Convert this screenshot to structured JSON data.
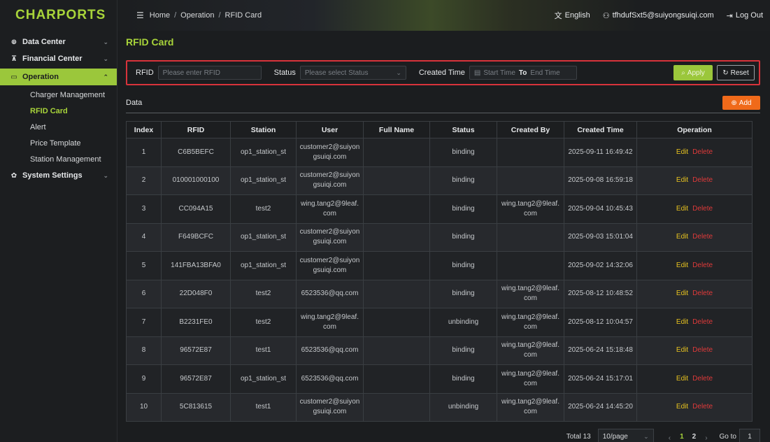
{
  "app": {
    "logo": "CHARPORTS"
  },
  "sidebar": {
    "items": [
      {
        "label": "Data Center",
        "icon": "dashboard-icon",
        "chevron": "⌄"
      },
      {
        "label": "Financial Center",
        "icon": "cart-icon",
        "chevron": "⌄"
      },
      {
        "label": "Operation",
        "icon": "monitor-icon",
        "chevron": "⌃"
      },
      {
        "label": "System Settings",
        "icon": "gear-icon",
        "chevron": "⌄"
      }
    ],
    "operation_children": [
      "Charger Management",
      "RFID Card",
      "Alert",
      "Price Template",
      "Station Management"
    ]
  },
  "header": {
    "breadcrumb": [
      "Home",
      "Operation",
      "RFID Card"
    ],
    "language": "English",
    "user_email": "tfhdufSxt5@suiyongsuiqi.com",
    "logout": "Log Out"
  },
  "page": {
    "title": "RFID Card"
  },
  "filter": {
    "rfid_label": "RFID",
    "rfid_placeholder": "Please enter RFID",
    "status_label": "Status",
    "status_placeholder": "Please select Status",
    "created_label": "Created Time",
    "start_placeholder": "Start Time",
    "to_label": "To",
    "end_placeholder": "End Time",
    "apply": "Apply",
    "reset": "Reset"
  },
  "data_section": {
    "label": "Data",
    "add": "Add"
  },
  "table": {
    "columns": [
      "Index",
      "RFID",
      "Station",
      "User",
      "Full Name",
      "Status",
      "Created By",
      "Created Time",
      "Operation"
    ],
    "rows": [
      [
        "1",
        "C6B5BEFC",
        "op1_station_st",
        "customer2@suiyongsuiqi.com",
        "",
        "binding",
        "",
        "2025-09-11 16:49:42"
      ],
      [
        "2",
        "010001000100",
        "op1_station_st",
        "customer2@suiyongsuiqi.com",
        "",
        "binding",
        "",
        "2025-09-08 16:59:18"
      ],
      [
        "3",
        "CC094A15",
        "test2",
        "wing.tang2@9leaf.com",
        "",
        "binding",
        "wing.tang2@9leaf.com",
        "2025-09-04 10:45:43"
      ],
      [
        "4",
        "F649BCFC",
        "op1_station_st",
        "customer2@suiyongsuiqi.com",
        "",
        "binding",
        "",
        "2025-09-03 15:01:04"
      ],
      [
        "5",
        "141FBA13BFA0",
        "op1_station_st",
        "customer2@suiyongsuiqi.com",
        "",
        "binding",
        "",
        "2025-09-02 14:32:06"
      ],
      [
        "6",
        "22D048F0",
        "test2",
        "6523536@qq.com",
        "",
        "binding",
        "wing.tang2@9leaf.com",
        "2025-08-12 10:48:52"
      ],
      [
        "7",
        "B2231FE0",
        "test2",
        "wing.tang2@9leaf.com",
        "",
        "unbinding",
        "wing.tang2@9leaf.com",
        "2025-08-12 10:04:57"
      ],
      [
        "8",
        "96572E87",
        "test1",
        "6523536@qq.com",
        "",
        "binding",
        "wing.tang2@9leaf.com",
        "2025-06-24 15:18:48"
      ],
      [
        "9",
        "96572E87",
        "op1_station_st",
        "6523536@qq.com",
        "",
        "binding",
        "wing.tang2@9leaf.com",
        "2025-06-24 15:17:01"
      ],
      [
        "10",
        "5C813615",
        "test1",
        "customer2@suiyongsuiqi.com",
        "",
        "unbinding",
        "wing.tang2@9leaf.com",
        "2025-06-24 14:45:20"
      ]
    ],
    "edit_label": "Edit",
    "delete_label": "Delete"
  },
  "pagination": {
    "total": "Total 13",
    "page_size": "10/page",
    "pages": [
      "1",
      "2"
    ],
    "current_page": "1",
    "goto_label": "Go to",
    "goto_value": "1"
  },
  "colors": {
    "accent": "#9bc73b",
    "logo": "#a8d43a",
    "add": "#f06a1a",
    "delete": "#e03a3a",
    "edit": "#e8c31f",
    "highlight_border": "#d8333b"
  }
}
